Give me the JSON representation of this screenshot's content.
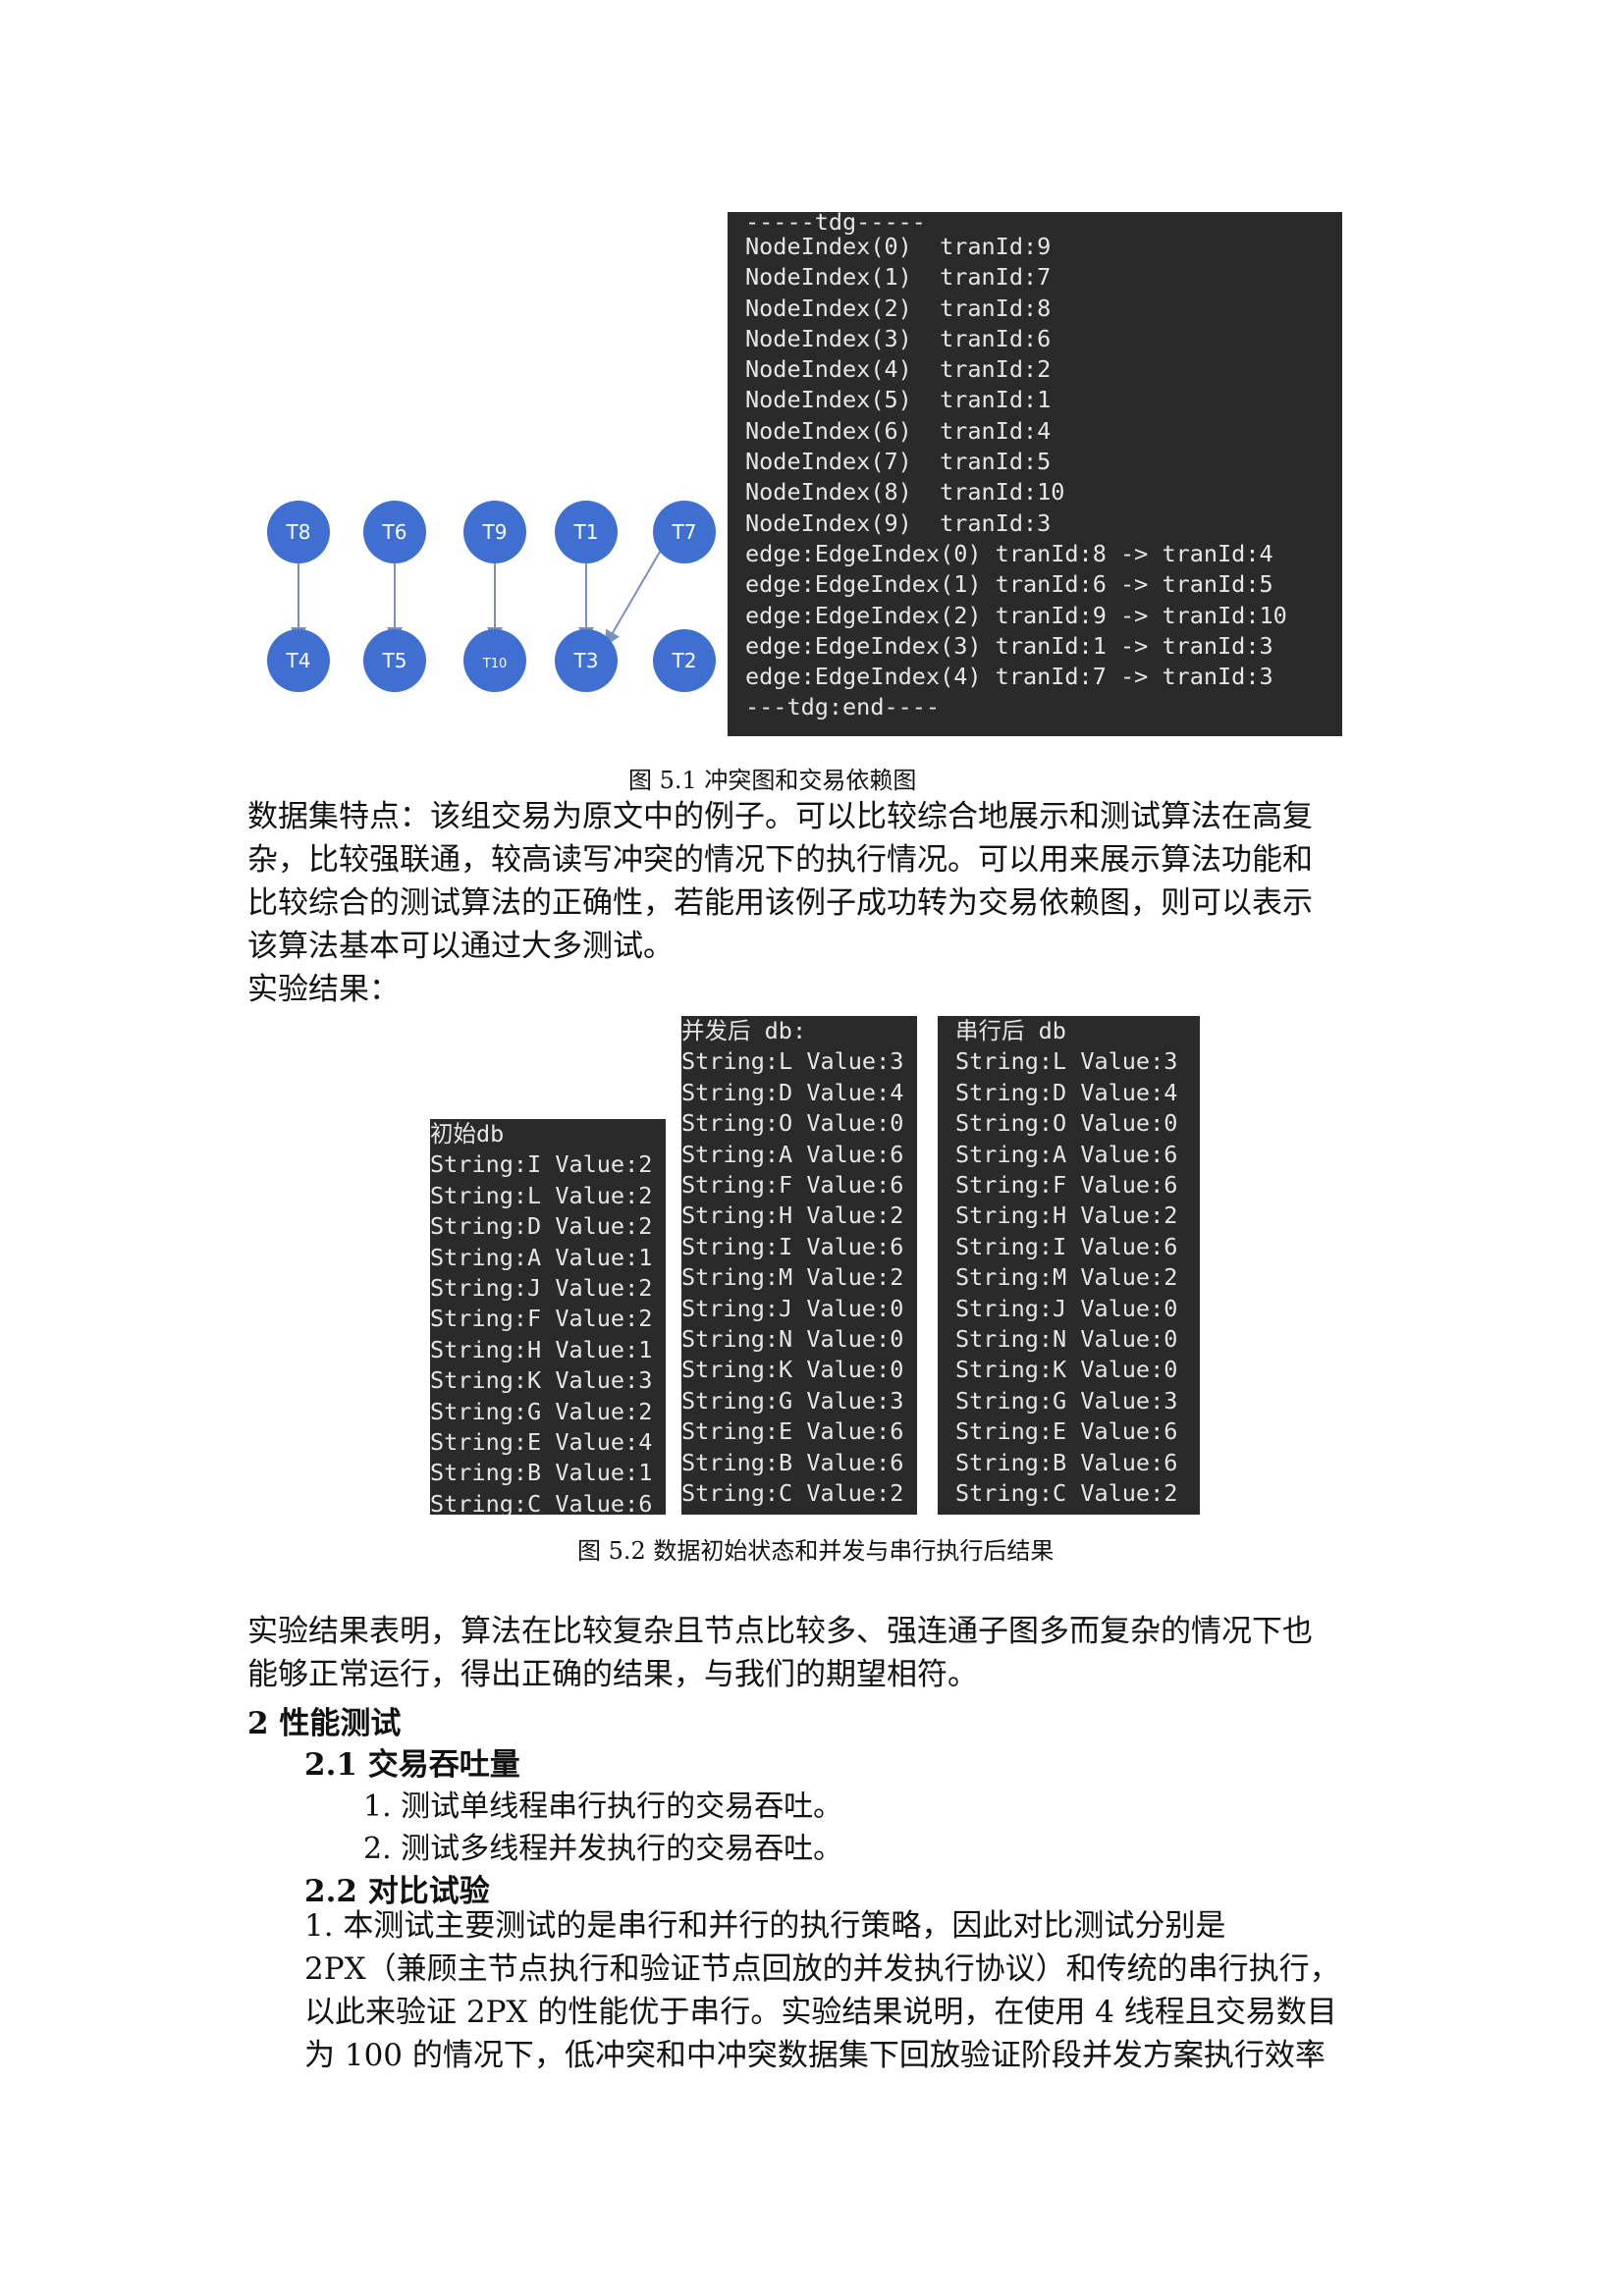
{
  "figure_graph": {
    "nodes": [
      "T8",
      "T6",
      "T9",
      "T1",
      "T7",
      "T4",
      "T5",
      "T10",
      "T3",
      "T2"
    ],
    "node_color": "#3f6fd1"
  },
  "terminal_tdg": {
    "lines": [
      "-----tdg-----",
      "NodeIndex(0)  tranId:9",
      "NodeIndex(1)  tranId:7",
      "NodeIndex(2)  tranId:8",
      "NodeIndex(3)  tranId:6",
      "NodeIndex(4)  tranId:2",
      "NodeIndex(5)  tranId:1",
      "NodeIndex(6)  tranId:4",
      "NodeIndex(7)  tranId:5",
      "NodeIndex(8)  tranId:10",
      "NodeIndex(9)  tranId:3",
      "edge:EdgeIndex(0) tranId:8 -> tranId:4",
      "edge:EdgeIndex(1) tranId:6 -> tranId:5",
      "edge:EdgeIndex(2) tranId:9 -> tranId:10",
      "edge:EdgeIndex(3) tranId:1 -> tranId:3",
      "edge:EdgeIndex(4) tranId:7 -> tranId:3",
      "---tdg:end----"
    ]
  },
  "caption1": "图 5.1 冲突图和交易依赖图",
  "para1": [
    "数据集特点：该组交易为原文中的例子。可以比较综合地展示和测试算法在高复",
    "杂，比较强联通，较高读写冲突的情况下的执行情况。可以用来展示算法功能和",
    "比较综合的测试算法的正确性，若能用该例子成功转为交易依赖图，则可以表示",
    "该算法基本可以通过大多测试。"
  ],
  "results_label": "实验结果：",
  "db_initial": {
    "title": "初始db",
    "lines": [
      "String:I Value:2",
      "String:L Value:2",
      "String:D Value:2",
      "String:A Value:1",
      "String:J Value:2",
      "String:F Value:2",
      "String:H Value:1",
      "String:K Value:3",
      "String:G Value:2",
      "String:E Value:4",
      "String:B Value:1",
      "String:C Value:6"
    ]
  },
  "db_parallel": {
    "title": "并发后 db:",
    "lines": [
      "String:L Value:3",
      "String:D Value:4",
      "String:O Value:0",
      "String:A Value:6",
      "String:F Value:6",
      "String:H Value:2",
      "String:I Value:6",
      "String:M Value:2",
      "String:J Value:0",
      "String:N Value:0",
      "String:K Value:0",
      "String:G Value:3",
      "String:E Value:6",
      "String:B Value:6",
      "String:C Value:2"
    ]
  },
  "db_serial": {
    "title": "串行后 db",
    "lines": [
      "String:L Value:3",
      "String:D Value:4",
      "String:O Value:0",
      "String:A Value:6",
      "String:F Value:6",
      "String:H Value:2",
      "String:I Value:6",
      "String:M Value:2",
      "String:J Value:0",
      "String:N Value:0",
      "String:K Value:0",
      "String:G Value:3",
      "String:E Value:6",
      "String:B Value:6",
      "String:C Value:2"
    ]
  },
  "caption2": "图 5.2 数据初始状态和并发与串行执行后结果",
  "para2": [
    "实验结果表明，算法在比较复杂且节点比较多、强连通子图多而复杂的情况下也",
    "能够正常运行，得出正确的结果，与我们的期望相符。"
  ],
  "heading2": "2 性能测试",
  "heading21": "2.1 交易吞吐量",
  "items21": [
    "1. 测试单线程串行执行的交易吞吐。",
    "2. 测试多线程并发执行的交易吞吐。"
  ],
  "heading22": "2.2 对比试验",
  "para3": [
    "   1. 本测试主要测试的是串行和并行的执行策略，因此对比测试分别是",
    "2PX（兼顾主节点执行和验证节点回放的并发执行协议）和传统的串行执行，",
    "以此来验证 2PX 的性能优于串行。实验结果说明，在使用 4 线程且交易数目",
    "为 100 的情况下，低冲突和中冲突数据集下回放验证阶段并发方案执行效率"
  ]
}
